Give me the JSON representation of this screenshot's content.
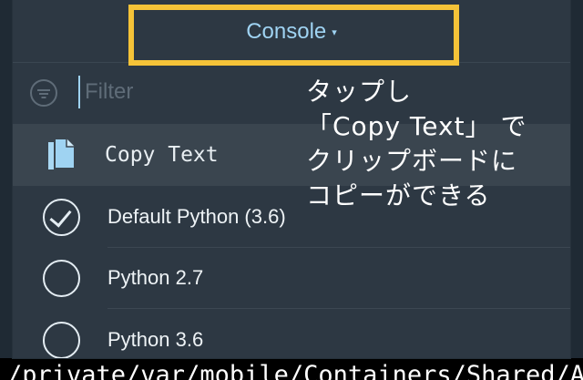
{
  "header": {
    "title": "Console",
    "caret": "▾"
  },
  "filter": {
    "placeholder": "Filter",
    "value": ""
  },
  "copy_item": {
    "label": "Copy Text",
    "icon": "copy-icon"
  },
  "interpreters": [
    {
      "label": "Default Python (3.6)",
      "selected": true
    },
    {
      "label": "Python 2.7",
      "selected": false
    },
    {
      "label": "Python 3.6",
      "selected": false
    }
  ],
  "annotation": {
    "lines": [
      "タップし",
      "「Copy Text」 で",
      "クリップボードに",
      "コピーができる"
    ]
  },
  "console_output": {
    "text": "/private/var/mobile/Containers/Shared/AppGroup/"
  },
  "colors": {
    "accent": "#9fd3f2",
    "highlight_border": "#f5c338",
    "panel": "#2d3843",
    "selected_row": "#3a454f"
  }
}
